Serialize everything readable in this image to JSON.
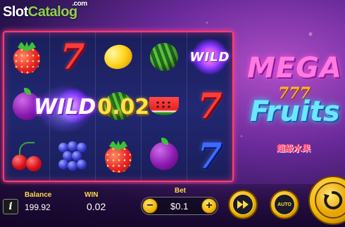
{
  "watermark": {
    "slot": "Slot",
    "catalog": "Catalog",
    "com": ".com"
  },
  "game_logo": {
    "mega": "MEGA",
    "sevens": "777",
    "fruits": "Fruits",
    "chinese": "超級水果"
  },
  "reels": {
    "columns": [
      [
        "strawberry",
        "plum",
        "cherries"
      ],
      [
        "seven-red",
        "wild",
        "grapes"
      ],
      [
        "lemon",
        "watermelon-whole",
        "strawberry"
      ],
      [
        "watermelon-whole",
        "watermelon-slice",
        "plum"
      ],
      [
        "wild",
        "seven-red",
        "seven-blue"
      ]
    ],
    "wild_label": "WILD"
  },
  "win_overlay": {
    "symbol": "WILD",
    "amount": "0.02"
  },
  "bottom_bar": {
    "balance_label": "Balance",
    "balance_value": "199.92",
    "win_label": "WIN",
    "win_value": "0.02",
    "bet_label": "Bet",
    "bet_value": "$0.1",
    "minus": "−",
    "plus": "+",
    "info": "i",
    "auto": "AUTO"
  },
  "colors": {
    "frame": "#ff3d6e",
    "label": "#ffd84a",
    "win_amount": "#ffe14a"
  }
}
